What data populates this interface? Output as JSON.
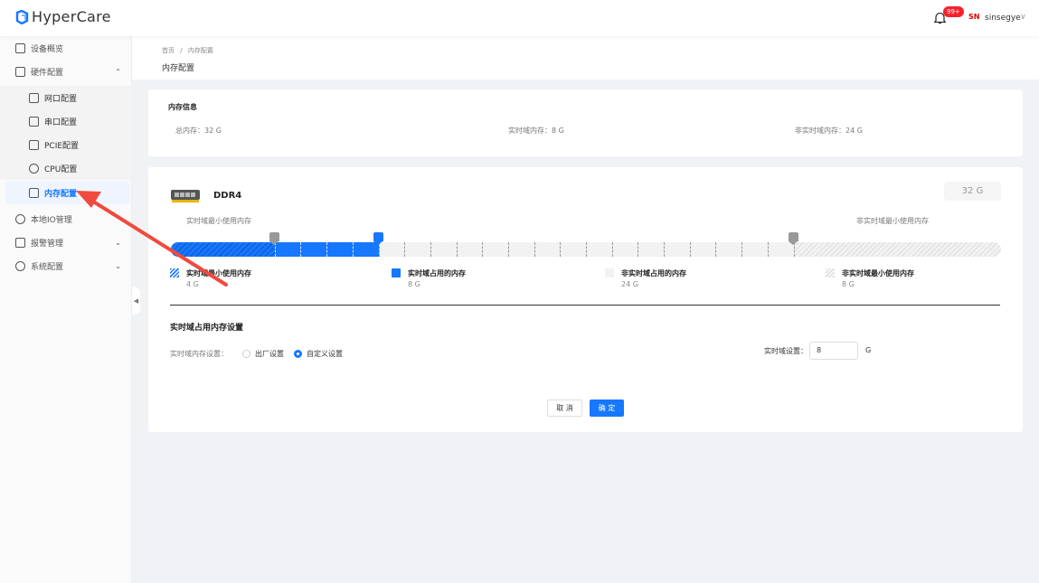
{
  "app": {
    "name": "HyperCare",
    "notification_count": "99+",
    "username": "sinsegye",
    "company_logo_text": "SN"
  },
  "sidebar": {
    "items": [
      {
        "label": "设备概览"
      },
      {
        "label": "硬件配置",
        "expanded": true
      },
      {
        "label": "网口配置"
      },
      {
        "label": "串口配置"
      },
      {
        "label": "PCIE配置"
      },
      {
        "label": "CPU配置"
      },
      {
        "label": "内存配置",
        "active": true
      },
      {
        "label": "本地IO管理"
      },
      {
        "label": "报警管理"
      },
      {
        "label": "系统配置"
      }
    ]
  },
  "breadcrumb": {
    "home": "首页",
    "sep": "/",
    "current": "内存配置"
  },
  "page_title": "内存配置",
  "memory_info": {
    "title": "内存信息",
    "total": "总内存：32 G",
    "realtime": "实时域内存：8 G",
    "non_realtime": "非实时域内存：24 G"
  },
  "ddr": {
    "type": "DDR4",
    "total": "32 G",
    "total_gb": 32,
    "rt_min_label": "实时域最小使用内存",
    "nrt_min_label": "非实时域最小使用内存",
    "rt_min_gb": 4,
    "rt_used_gb": 8,
    "nrt_min_gb": 8
  },
  "legend": [
    {
      "label": "实时域最小使用内存",
      "value": "4 G"
    },
    {
      "label": "实时域占用的内存",
      "value": "8 G"
    },
    {
      "label": "非实时域占用的内存",
      "value": "24 G"
    },
    {
      "label": "非实时域最小使用内存",
      "value": "8 G"
    }
  ],
  "settings": {
    "title": "实时域占用内存设置",
    "mode_label": "实时域内存设置：",
    "option_factory": "出厂设置",
    "option_custom": "自定义设置",
    "selected": "custom",
    "rt_label": "实时域设置：",
    "rt_value": "8",
    "unit": "G"
  },
  "buttons": {
    "cancel": "取 消",
    "ok": "确 定"
  },
  "colors": {
    "accent": "#1677ff",
    "annotation": "#f04a3e"
  }
}
